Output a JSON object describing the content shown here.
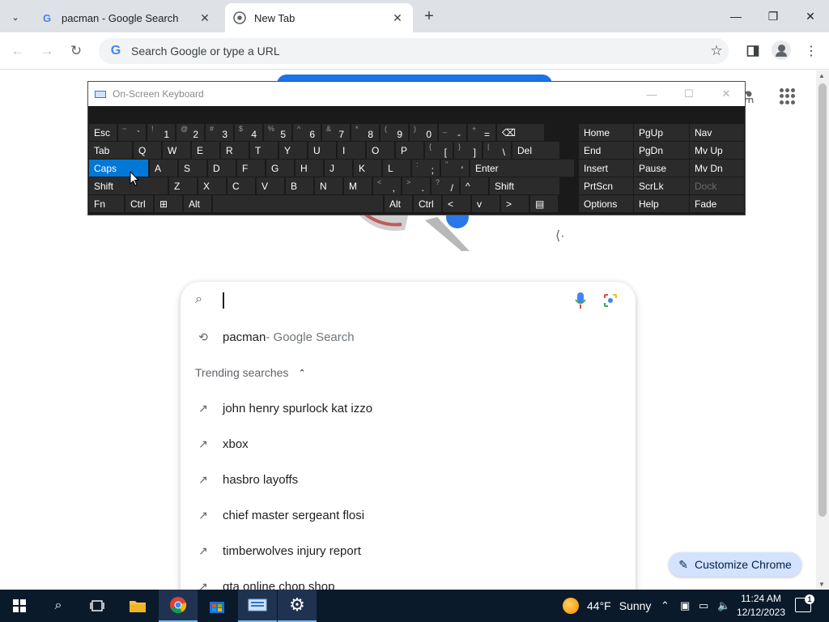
{
  "browser": {
    "tabs": [
      {
        "title": "pacman - Google Search",
        "favicon": "G",
        "active": false
      },
      {
        "title": "New Tab",
        "favicon": "chrome-icon",
        "active": true
      }
    ],
    "omnibox_placeholder": "Search Google or type a URL",
    "window_controls": {
      "minimize": "—",
      "restore": "❐",
      "close": "✕"
    }
  },
  "osk": {
    "title": "On-Screen Keyboard",
    "rows": [
      [
        {
          "main": "Esc"
        },
        {
          "shift": "~",
          "main": "`"
        },
        {
          "shift": "!",
          "main": "1"
        },
        {
          "shift": "@",
          "main": "2"
        },
        {
          "shift": "#",
          "main": "3"
        },
        {
          "shift": "$",
          "main": "4"
        },
        {
          "shift": "%",
          "main": "5"
        },
        {
          "shift": "^",
          "main": "6"
        },
        {
          "shift": "&",
          "main": "7"
        },
        {
          "shift": "*",
          "main": "8"
        },
        {
          "shift": "(",
          "main": "9"
        },
        {
          "shift": ")",
          "main": "0"
        },
        {
          "shift": "_",
          "main": "-"
        },
        {
          "shift": "+",
          "main": "="
        },
        {
          "main": "⌫"
        }
      ],
      [
        {
          "main": "Tab"
        },
        {
          "main": "Q"
        },
        {
          "main": "W"
        },
        {
          "main": "E"
        },
        {
          "main": "R"
        },
        {
          "main": "T"
        },
        {
          "main": "Y"
        },
        {
          "main": "U"
        },
        {
          "main": "I"
        },
        {
          "main": "O"
        },
        {
          "main": "P"
        },
        {
          "shift": "{",
          "main": "["
        },
        {
          "shift": "}",
          "main": "]"
        },
        {
          "shift": "|",
          "main": "\\"
        },
        {
          "main": "Del"
        }
      ],
      [
        {
          "main": "Caps"
        },
        {
          "main": "A"
        },
        {
          "main": "S"
        },
        {
          "main": "D"
        },
        {
          "main": "F"
        },
        {
          "main": "G"
        },
        {
          "main": "H"
        },
        {
          "main": "J"
        },
        {
          "main": "K"
        },
        {
          "main": "L"
        },
        {
          "shift": ":",
          "main": ";"
        },
        {
          "shift": "\"",
          "main": "'"
        },
        {
          "main": "Enter"
        }
      ],
      [
        {
          "main": "Shift"
        },
        {
          "main": "Z"
        },
        {
          "main": "X"
        },
        {
          "main": "C"
        },
        {
          "main": "V"
        },
        {
          "main": "B"
        },
        {
          "main": "N"
        },
        {
          "main": "M"
        },
        {
          "shift": "<",
          "main": ","
        },
        {
          "shift": ">",
          "main": "."
        },
        {
          "shift": "?",
          "main": "/"
        },
        {
          "main": "^"
        },
        {
          "main": "Shift"
        }
      ],
      [
        {
          "main": "Fn"
        },
        {
          "main": "Ctrl"
        },
        {
          "main": "⊞"
        },
        {
          "main": "Alt"
        },
        {
          "main": ""
        },
        {
          "main": "Alt"
        },
        {
          "main": "Ctrl"
        },
        {
          "main": "<"
        },
        {
          "main": "v"
        },
        {
          "main": ">"
        },
        {
          "main": "▤"
        }
      ]
    ],
    "nav_keys": [
      [
        "Home",
        "PgUp",
        "Nav"
      ],
      [
        "End",
        "PgDn",
        "Mv Up"
      ],
      [
        "Insert",
        "Pause",
        "Mv Dn"
      ],
      [
        "PrtScn",
        "ScrLk",
        "Dock"
      ],
      [
        "Options",
        "Help",
        "Fade"
      ]
    ]
  },
  "search": {
    "recent": {
      "query": "pacman",
      "suffix": " - Google Search"
    },
    "trending_label": "Trending searches",
    "trending": [
      "john henry spurlock kat izzo",
      "xbox",
      "hasbro layoffs",
      "chief master sergeant flosi",
      "timberwolves injury report",
      "gta online chop shop"
    ]
  },
  "customize_label": "Customize Chrome",
  "taskbar": {
    "weather_temp": "44°F",
    "weather_cond": "Sunny",
    "time": "11:24 AM",
    "date": "12/12/2023",
    "notification_count": "1"
  },
  "colors": {
    "caps_active": "#0078d7",
    "customize_bg": "#d3e3fd",
    "taskbar_bg": "#0b1a2b"
  }
}
